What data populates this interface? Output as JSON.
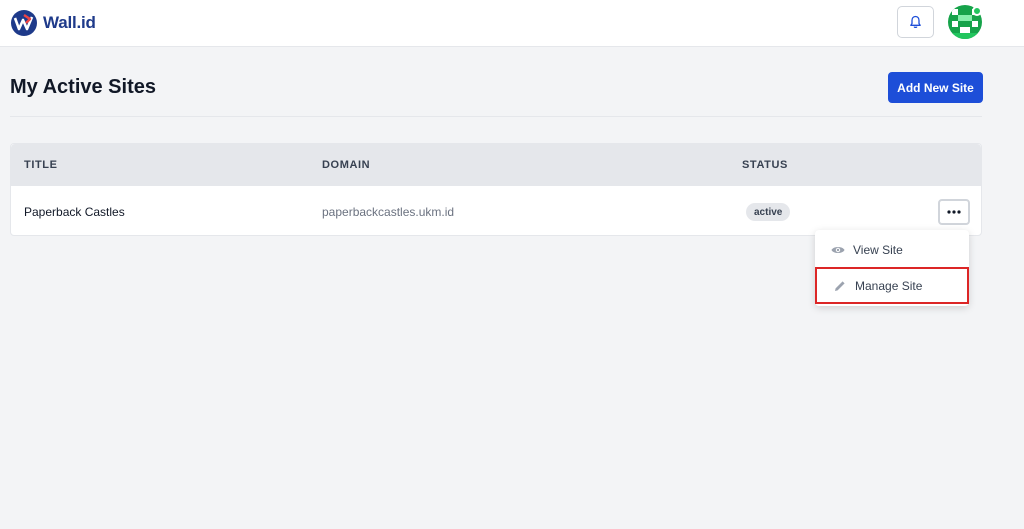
{
  "header": {
    "brand_name": "Wall.id",
    "icons": {
      "logo": "wall-id-logo-icon",
      "bell": "bell-icon",
      "avatar": "avatar-icon"
    }
  },
  "page": {
    "title": "My Active Sites",
    "add_button_label": "Add New Site"
  },
  "table": {
    "columns": [
      "TITLE",
      "DOMAIN",
      "STATUS"
    ],
    "rows": [
      {
        "title": "Paperback Castles",
        "domain": "paperbackcastles.ukm.id",
        "status": "active"
      }
    ]
  },
  "row_menu": {
    "items": [
      {
        "label": "View Site",
        "icon": "eye-icon"
      },
      {
        "label": "Manage Site",
        "icon": "pencil-icon"
      }
    ]
  },
  "colors": {
    "accent": "#1d4ed8",
    "highlight": "#dc2626",
    "status_online": "#22c55e"
  }
}
